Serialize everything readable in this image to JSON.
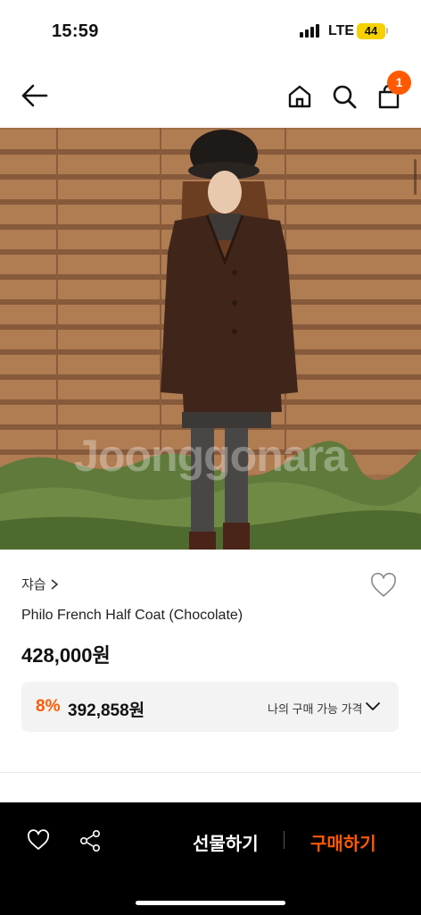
{
  "status_bar": {
    "time": "15:59",
    "network": "LTE",
    "battery": "44"
  },
  "header": {
    "cart_count": "1"
  },
  "product": {
    "watermark": "Joonggonara",
    "brand": "쟈습",
    "name": "Philo French Half Coat (Chocolate)",
    "price": "428,000원",
    "discount_rate": "8%",
    "discount_price": "392,858원",
    "discount_label": "나의 구매 가능 가격"
  },
  "bottom_bar": {
    "gift_label": "선물하기",
    "buy_label": "구매하기"
  },
  "colors": {
    "accent": "#ff5a00",
    "bottom_bar": "#000000",
    "battery": "#f5d100"
  },
  "icons": [
    "back-arrow-icon",
    "home-icon",
    "search-icon",
    "shopping-bag-icon",
    "chevron-right-icon",
    "heart-icon",
    "chevron-down-icon",
    "share-icon"
  ]
}
